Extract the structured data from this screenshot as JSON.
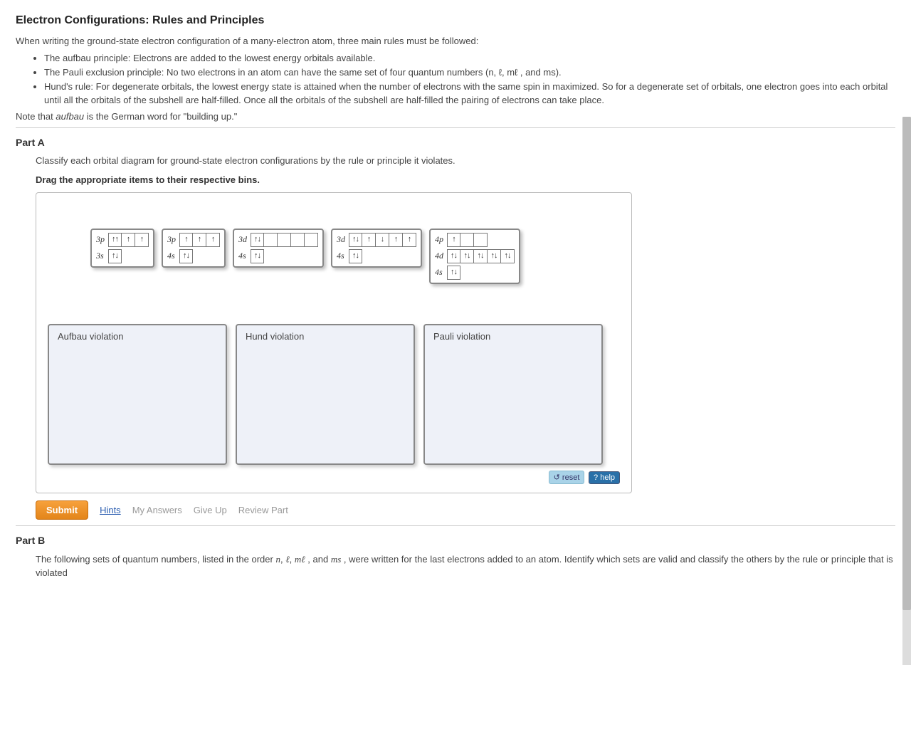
{
  "title": "Electron Configurations: Rules and Principles",
  "intro": "When writing the ground-state electron configuration of a many-electron atom, three main rules must be followed:",
  "rules": [
    "The aufbau principle: Electrons are added to the lowest energy orbitals available.",
    "The Pauli exclusion principle: No two electrons in an atom can have the same set of four quantum numbers (n, ℓ, mℓ , and ms).",
    "Hund's rule: For degenerate orbitals, the lowest energy state is attained when the number of electrons with the same spin in maximized. So for a degenerate set of orbitals, one electron goes into each orbital until all the orbitals of the subshell are half-filled. Once all the orbitals of the subshell are half-filled the pairing of electrons can take place."
  ],
  "note_pre": "Note that ",
  "note_em": "aufbau",
  "note_post": " is the German word for \"building up.\"",
  "partA": {
    "header": "Part A",
    "instruct": "Classify each orbital diagram for ground-state electron configurations by the rule or principle it violates.",
    "drag": "Drag the appropriate items to their respective bins.",
    "bins": {
      "aufbau": "Aufbau violation",
      "hund": "Hund violation",
      "pauli": "Pauli violation"
    },
    "reset": "reset",
    "help": "help",
    "submit": "Submit",
    "hints": "Hints",
    "myanswers": "My Answers",
    "giveup": "Give Up",
    "review": "Review Part",
    "items": [
      {
        "rows": [
          {
            "label": "3p",
            "boxes": [
              "↑↑",
              "↑",
              "↑"
            ]
          },
          {
            "label": "3s",
            "boxes": [
              "↑↓"
            ]
          }
        ]
      },
      {
        "rows": [
          {
            "label": "3p",
            "boxes": [
              "↑",
              "↑",
              "↑"
            ]
          },
          {
            "label": "4s",
            "boxes": [
              "↑↓"
            ]
          }
        ]
      },
      {
        "rows": [
          {
            "label": "3d",
            "boxes": [
              "↑↓",
              "",
              "",
              "",
              ""
            ]
          },
          {
            "label": "4s",
            "boxes": [
              "↑↓"
            ]
          }
        ]
      },
      {
        "rows": [
          {
            "label": "3d",
            "boxes": [
              "↑↓",
              "↑",
              "↓",
              "↑",
              "↑"
            ]
          },
          {
            "label": "4s",
            "boxes": [
              "↑↓"
            ]
          }
        ]
      },
      {
        "rows": [
          {
            "label": "4p",
            "boxes": [
              "↑",
              "",
              ""
            ]
          },
          {
            "label": "4d",
            "boxes": [
              "↑↓",
              "↑↓",
              "↑↓",
              "↑↓",
              "↑↓"
            ]
          },
          {
            "label": "4s",
            "boxes": [
              "↑↓"
            ]
          }
        ]
      }
    ]
  },
  "partB": {
    "header": "Part B",
    "text_pre": "The following sets of quantum numbers, listed in the order ",
    "q1": "n",
    "c1": ", ",
    "q2": "ℓ",
    "c2": ", ",
    "q3": "mℓ",
    "c3": " , and ",
    "q4": "ms",
    "text_post": " , were written for the last electrons added to an atom. Identify which sets are valid and classify the others by the rule or principle that is violated"
  }
}
